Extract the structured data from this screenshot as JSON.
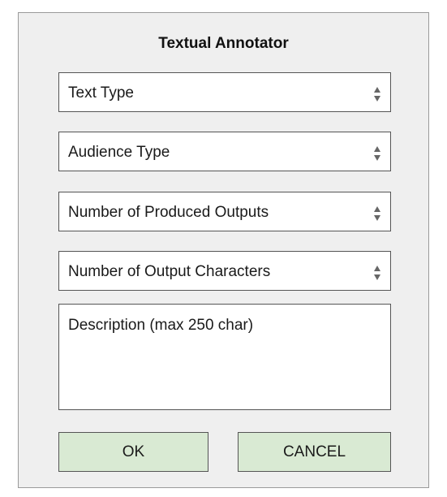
{
  "dialog": {
    "title": "Textual Annotator"
  },
  "fields": {
    "text_type": {
      "label": "Text Type",
      "icon": "updown-arrows-icon"
    },
    "audience_type": {
      "label": "Audience Type",
      "icon": "updown-arrows-icon"
    },
    "produced_outputs": {
      "label": "Number of Produced Outputs",
      "icon": "updown-arrows-icon"
    },
    "output_characters": {
      "label": "Number of Output Characters",
      "icon": "updown-arrows-icon"
    }
  },
  "description": {
    "placeholder": "Description (max 250 char)"
  },
  "buttons": {
    "ok_label": "OK",
    "cancel_label": "CANCEL"
  },
  "colors": {
    "dialog_bg": "#efefef",
    "button_bg": "#d9ead3",
    "border": "#555555"
  }
}
